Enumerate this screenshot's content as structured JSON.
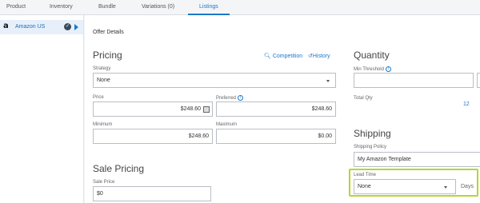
{
  "tabs": [
    {
      "label": "Product"
    },
    {
      "label": "Inventory"
    },
    {
      "label": "Bundle"
    },
    {
      "label": "Variations (0)"
    },
    {
      "label": "Listings"
    }
  ],
  "sidebar": {
    "channel_logo": "a",
    "channel_label": "Amazon US",
    "status_icon": "check-circle-icon",
    "expand_icon": "play-arrow-icon"
  },
  "main": {
    "section_title": "Offer Details",
    "pricing": {
      "heading": "Pricing",
      "competition_link": "Competition",
      "history_link": "History",
      "strategy_label": "Strategy",
      "strategy_value": "None",
      "price_label": "Price",
      "price_value": "$248.60",
      "preferred_label": "Preferred",
      "preferred_value": "$248.60",
      "minimum_label": "Minimum",
      "minimum_value": "$248.60",
      "maximum_label": "Maximum",
      "maximum_value": "$0.00"
    },
    "sale_pricing": {
      "heading": "Sale Pricing",
      "sale_price_label": "Sale Price",
      "sale_price_value": "$0"
    },
    "quantity": {
      "heading": "Quantity",
      "min_threshold_label": "Min Threshold",
      "min_threshold_value": "",
      "total_qty_label": "Total Qty",
      "total_qty_value": "12"
    },
    "shipping": {
      "heading": "Shipping",
      "policy_label": "Shipping Policy",
      "policy_value": "My Amazon Template",
      "lead_time_label": "Lead Time",
      "lead_time_value": "None",
      "lead_time_unit": "Days"
    }
  },
  "colors": {
    "accent": "#1b78c8",
    "highlight": "#b6d630"
  }
}
